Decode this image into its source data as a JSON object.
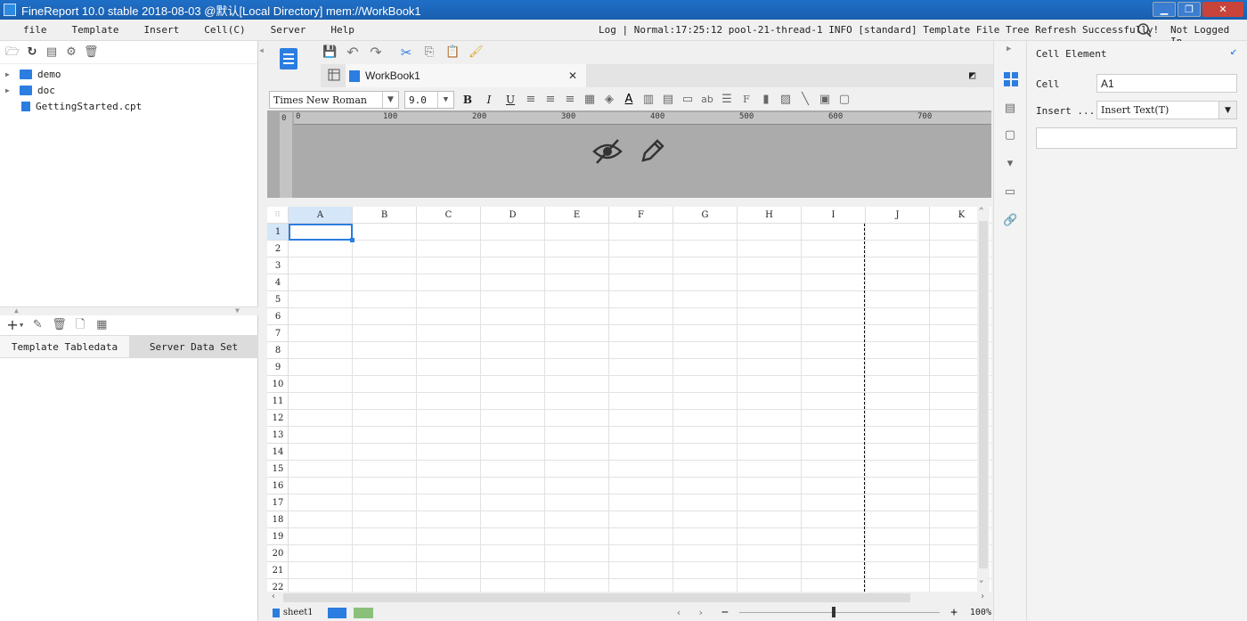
{
  "window": {
    "title": "FineReport 10.0 stable 2018-08-03 @默认[Local Directory]    mem://WorkBook1"
  },
  "menu": {
    "items": [
      "file",
      "Template",
      "Insert",
      "Cell(C)",
      "Server",
      "Help"
    ],
    "log_text": "Log | Normal:17:25:12 pool-21-thread-1 INFO [standard] Template File Tree Refresh Successfully!",
    "login_text": "Not Logged In"
  },
  "file_tree": {
    "items": [
      {
        "name": "demo",
        "type": "folder"
      },
      {
        "name": "doc",
        "type": "folder"
      },
      {
        "name": "GettingStarted.cpt",
        "type": "file"
      }
    ]
  },
  "dataset_tabs": {
    "left": "Template Tabledata",
    "right": "Server Data Set"
  },
  "editor": {
    "tab_title": "WorkBook1",
    "font_name": "Times New Roman",
    "font_size": "9.0",
    "ruler_marks": [
      "0",
      "100",
      "200",
      "300",
      "400",
      "500",
      "600",
      "700"
    ],
    "vruler_mark": "0"
  },
  "grid": {
    "columns": [
      "A",
      "B",
      "C",
      "D",
      "E",
      "F",
      "G",
      "H",
      "I",
      "J",
      "K"
    ],
    "rows": [
      "1",
      "2",
      "3",
      "4",
      "5",
      "6",
      "7",
      "8",
      "9",
      "10",
      "11",
      "12",
      "13",
      "14",
      "15",
      "16",
      "17",
      "18",
      "19",
      "20",
      "21",
      "22"
    ],
    "selected_cell": "A1"
  },
  "sheetbar": {
    "sheet_name": "sheet1",
    "zoom": "100%"
  },
  "cell_panel": {
    "title": "Cell Element",
    "cell_label": "Cell",
    "cell_value": "A1",
    "insert_label": "Insert ...",
    "insert_value": "Insert Text(T)"
  },
  "colors": {
    "titlebar": "#1f6fc7",
    "accent": "#2b7de0",
    "selection": "#2b7de0"
  }
}
